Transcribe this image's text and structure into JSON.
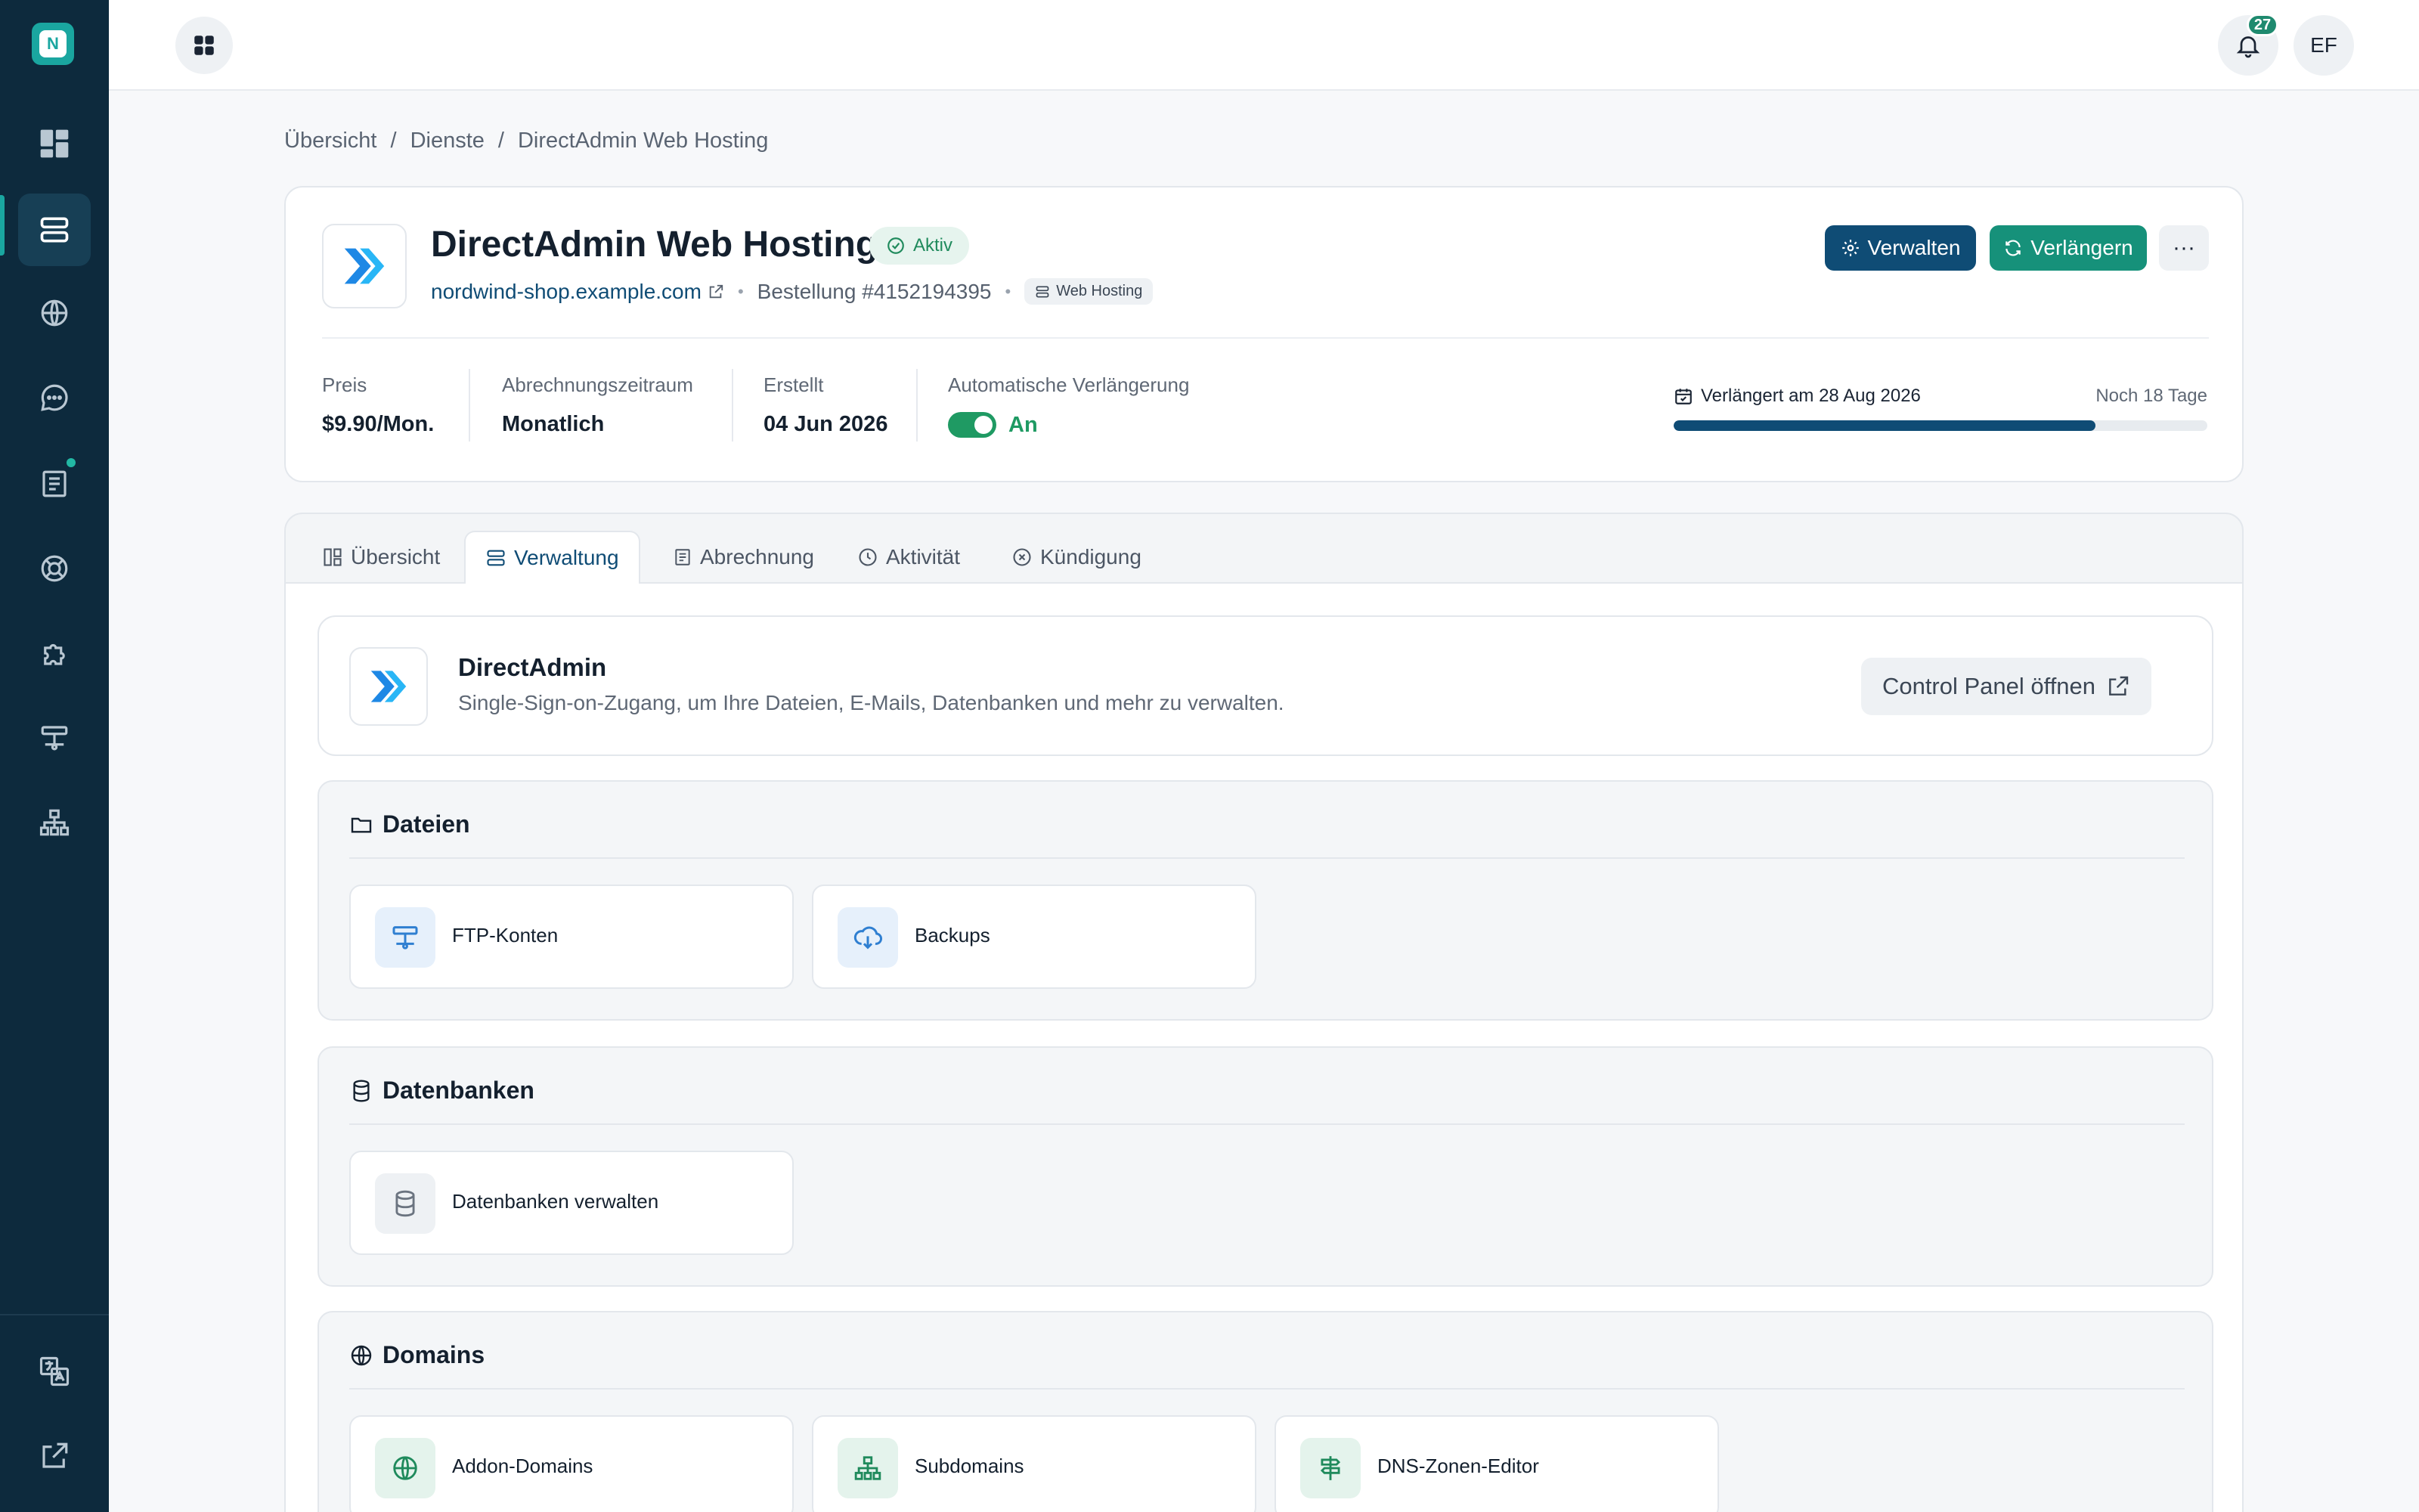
{
  "sidebar": {
    "logo_letter": "N",
    "items": [
      {
        "icon": "dashboard-icon"
      },
      {
        "icon": "server-icon"
      },
      {
        "icon": "globe-icon"
      },
      {
        "icon": "chat-icon"
      },
      {
        "icon": "invoice-icon"
      },
      {
        "icon": "support-icon"
      },
      {
        "icon": "puzzle-icon"
      },
      {
        "icon": "network-icon"
      },
      {
        "icon": "sitemap-icon"
      }
    ],
    "bottom": [
      {
        "icon": "translate-icon"
      },
      {
        "icon": "external-link-icon"
      }
    ]
  },
  "topbar": {
    "notification_count": "27",
    "avatar_initials": "EF"
  },
  "breadcrumb": [
    "Übersicht",
    "/",
    "Dienste",
    "/",
    "DirectAdmin Web Hosting"
  ],
  "service": {
    "title": "DirectAdmin Web Hosting",
    "status": "Aktiv",
    "domain": "nordwind-shop.example.com",
    "order": "Bestellung #4152194395",
    "tag": "Web Hosting",
    "actions": {
      "manage": "Verwalten",
      "renew": "Verlängern",
      "more": "···"
    }
  },
  "stats": {
    "price_label": "Preis",
    "price_value": "$9.90/Mon.",
    "period_label": "Abrechnungszeitraum",
    "period_value": "Monatlich",
    "created_label": "Erstellt",
    "created_value": "04 Jun 2026",
    "autorenew_label": "Automatische Verlängerung",
    "autorenew_value": "An"
  },
  "renewal": {
    "label": "Verlängert am 28 Aug 2026",
    "remaining": "Noch 18 Tage",
    "progress": 0.79
  },
  "tabs": [
    {
      "label": "Übersicht",
      "icon": "layout-icon"
    },
    {
      "label": "Verwaltung",
      "icon": "server-icon",
      "active": true
    },
    {
      "label": "Abrechnung",
      "icon": "invoice-icon"
    },
    {
      "label": "Aktivität",
      "icon": "clock-icon"
    },
    {
      "label": "Kündigung",
      "icon": "cancel-icon"
    }
  ],
  "sso": {
    "title": "DirectAdmin",
    "description": "Single-Sign-on-Zugang, um Ihre Dateien, E-Mails, Datenbanken und mehr zu verwalten.",
    "button": "Control Panel öffnen"
  },
  "sections": {
    "files": {
      "title": "Dateien",
      "tiles": [
        "FTP-Konten",
        "Backups"
      ]
    },
    "databases": {
      "title": "Datenbanken",
      "tiles": [
        "Datenbanken verwalten"
      ]
    },
    "domains": {
      "title": "Domains",
      "tiles": [
        "Addon-Domains",
        "Subdomains",
        "DNS-Zonen-Editor"
      ]
    }
  },
  "colors": {
    "sidebar": "#0d2a3d",
    "primary": "#0f4c75",
    "accent": "#16917a",
    "success": "#1f9a63"
  }
}
